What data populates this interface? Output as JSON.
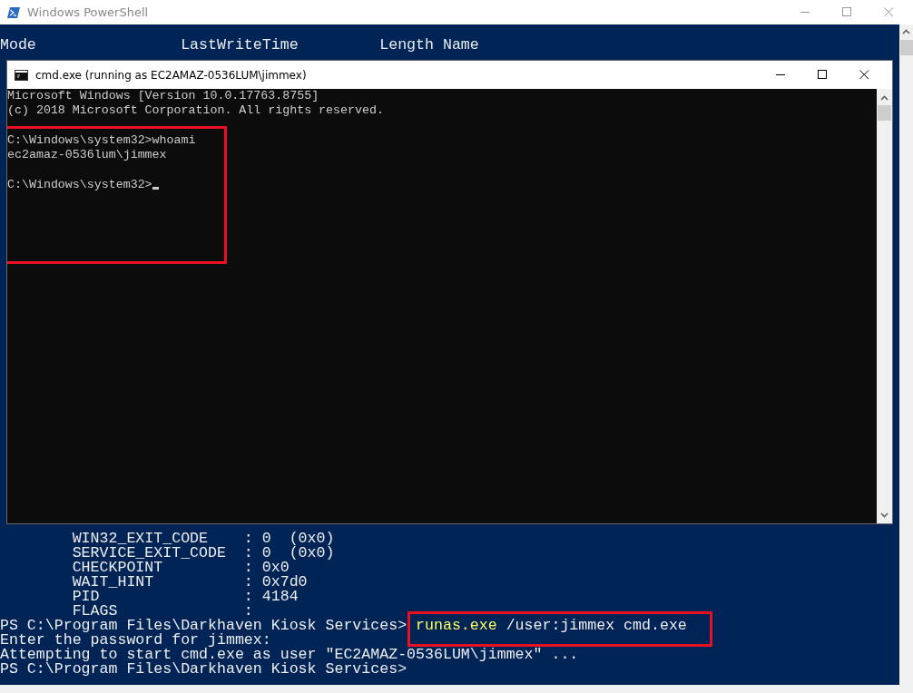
{
  "window": {
    "title": "Windows PowerShell"
  },
  "console": {
    "header": "Mode                LastWriteTime         Length Name",
    "service_lines": [
      "        WIN32_EXIT_CODE    : 0  (0x0)",
      "        SERVICE_EXIT_CODE  : 0  (0x0)",
      "        CHECKPOINT         : 0x0",
      "        WAIT_HINT          : 0x7d0",
      "        PID                : 4184",
      "        FLAGS              :"
    ],
    "session": [
      {
        "kind": "input",
        "prompt": "PS C:\\Program Files\\Darkhaven Kiosk Services> ",
        "command": "runas.exe",
        "arguments": " /user:jimmex cmd.exe",
        "highlighted": true
      },
      {
        "kind": "output",
        "text": "Enter the password for jimmex:"
      },
      {
        "kind": "output",
        "text": "Attempting to start cmd.exe as user \"EC2AMAZ-0536LUM\\jimmex\" ..."
      },
      {
        "kind": "prompt",
        "prompt": "PS C:\\Program Files\\Darkhaven Kiosk Services>"
      }
    ]
  },
  "cmd_window": {
    "title": "cmd.exe (running as EC2AMAZ-0536LUM\\jimmex)",
    "banner": [
      "Microsoft Windows [Version 10.0.17763.8755]",
      "(c) 2018 Microsoft Corporation. All rights reserved."
    ],
    "highlighted": true,
    "session": [
      {
        "kind": "input",
        "prompt": "C:\\Windows\\system32>",
        "command": "whoami"
      },
      {
        "kind": "output",
        "text": "ec2amaz-0536lum\\jimmex"
      },
      {
        "kind": "prompt",
        "prompt": "C:\\Windows\\system32>",
        "cursor": true
      }
    ]
  }
}
